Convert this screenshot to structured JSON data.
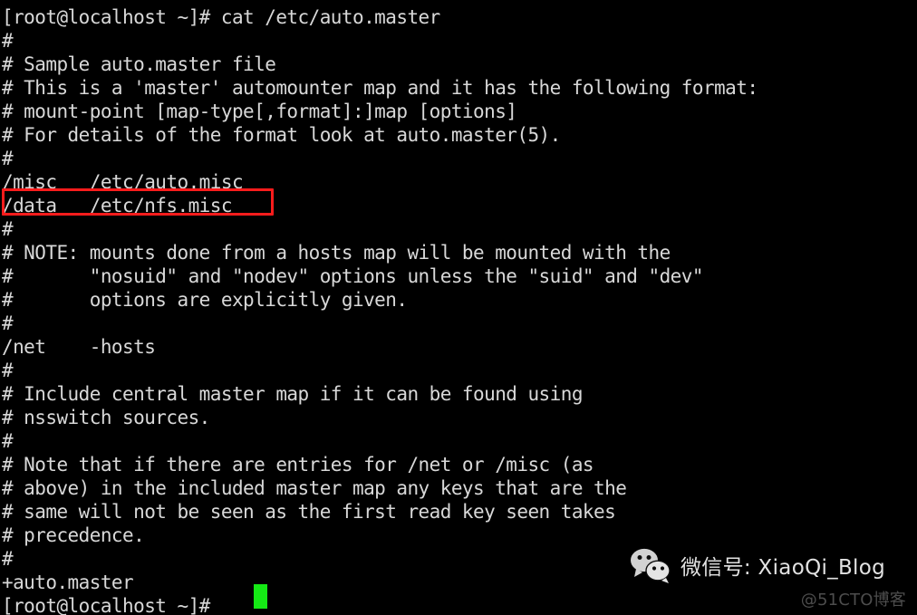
{
  "terminal": {
    "prompt_command_line": "[root@localhost ~]# cat /etc/auto.master",
    "file_path": "/etc/auto.master",
    "final_prompt": "[root@localhost ~]# ",
    "cursor": {
      "shape": "block",
      "color": "#15e915",
      "column": 20
    },
    "colors": {
      "background": "#000000",
      "foreground": "#d8d8d8",
      "cursor": "#15e915",
      "annotation": "#fb1c1c"
    },
    "lines": [
      {
        "id": "line-partial-top",
        "text": "",
        "dim": true
      },
      {
        "id": "line-prompt-cat",
        "text": "[root@localhost ~]# cat /etc/auto.master"
      },
      {
        "id": "line-hash-1",
        "text": "#"
      },
      {
        "id": "line-sample",
        "text": "# Sample auto.master file"
      },
      {
        "id": "line-this-is",
        "text": "# This is a 'master' automounter map and it has the following format:"
      },
      {
        "id": "line-mount-point",
        "text": "# mount-point [map-type[,format]:]map [options]"
      },
      {
        "id": "line-for-details",
        "text": "# For details of the format look at auto.master(5)."
      },
      {
        "id": "line-hash-2",
        "text": "#"
      },
      {
        "id": "line-misc",
        "text": "/misc   /etc/auto.misc"
      },
      {
        "id": "line-data",
        "text": "/data   /etc/nfs.misc"
      },
      {
        "id": "line-hash-3",
        "text": "#"
      },
      {
        "id": "line-note-mounts",
        "text": "# NOTE: mounts done from a hosts map will be mounted with the"
      },
      {
        "id": "line-nosuid",
        "text": "#       \"nosuid\" and \"nodev\" options unless the \"suid\" and \"dev\""
      },
      {
        "id": "line-options-explicit",
        "text": "#       options are explicitly given."
      },
      {
        "id": "line-hash-4",
        "text": "#"
      },
      {
        "id": "line-net",
        "text": "/net    -hosts"
      },
      {
        "id": "line-hash-5",
        "text": "#"
      },
      {
        "id": "line-include-central",
        "text": "# Include central master map if it can be found using"
      },
      {
        "id": "line-nsswitch",
        "text": "# nsswitch sources."
      },
      {
        "id": "line-hash-6",
        "text": "#"
      },
      {
        "id": "line-note-entries",
        "text": "# Note that if there are entries for /net or /misc (as"
      },
      {
        "id": "line-above-included",
        "text": "# above) in the included master map any keys that are the"
      },
      {
        "id": "line-same-will-not",
        "text": "# same will not be seen as the first read key seen takes"
      },
      {
        "id": "line-precedence",
        "text": "# precedence."
      },
      {
        "id": "line-hash-7",
        "text": "#"
      },
      {
        "id": "line-plus-auto-master",
        "text": "+auto.master"
      },
      {
        "id": "line-final-prompt",
        "text": "[root@localhost ~]# "
      }
    ]
  },
  "annotation": {
    "name": "red-highlight-box",
    "target_line_text": "/data   /etc/nfs.misc",
    "color": "#fb1c1c"
  },
  "watermark": {
    "logo_name": "wechat-logo",
    "handle_text": "微信号: XiaoQi_Blog",
    "credit_text": "@51CTO博客"
  }
}
